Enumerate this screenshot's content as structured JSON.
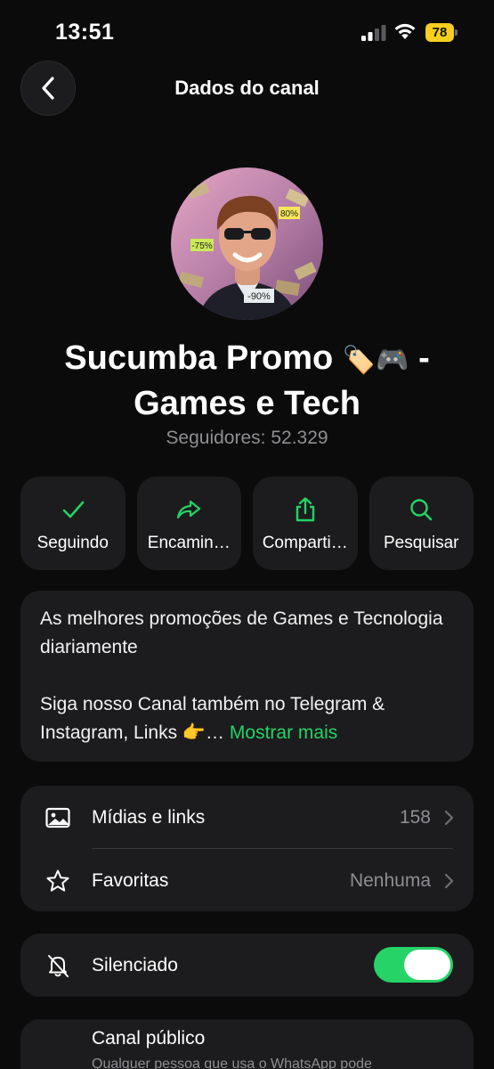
{
  "status_bar": {
    "time": "13:51",
    "battery": "78",
    "icons": [
      "signal-icon",
      "wifi-icon",
      "battery-icon"
    ]
  },
  "nav": {
    "title": "Dados do canal",
    "back_icon": "chevron-left-icon"
  },
  "channel": {
    "name_line1": "Sucumba Promo",
    "name_emojis": "🏷️🎮",
    "name_dash": "-",
    "name_line2": "Games e Tech",
    "followers": "Seguidores: 52.329",
    "avatar_badges": [
      "80%",
      "-75%",
      "-90%"
    ]
  },
  "actions": [
    {
      "label": "Seguindo",
      "icon": "check-icon"
    },
    {
      "label": "Encamin…",
      "icon": "forward-icon"
    },
    {
      "label": "Comparti…",
      "icon": "share-icon"
    },
    {
      "label": "Pesquisar",
      "icon": "search-icon"
    }
  ],
  "description": {
    "paragraph1": "As melhores promoções de Games e Tecnologia diariamente",
    "paragraph2": "Siga nosso Canal também no Telegram & Instagram, Links 👉…",
    "more_link": "Mostrar mais"
  },
  "media_card": {
    "media_label": "Mídias e links",
    "media_count": "158",
    "favorites_label": "Favoritas",
    "favorites_value": "Nenhuma"
  },
  "mute_card": {
    "label": "Silenciado",
    "toggle_on": true
  },
  "public_card": {
    "title": "Canal público",
    "subtitle": "Qualquer pessoa que usa o WhatsApp pode"
  },
  "colors": {
    "accent": "#25d366",
    "background": "#0b0b0b",
    "card": "#1c1c1e",
    "secondary_text": "#8e8e93",
    "battery": "#f5cf1f"
  }
}
